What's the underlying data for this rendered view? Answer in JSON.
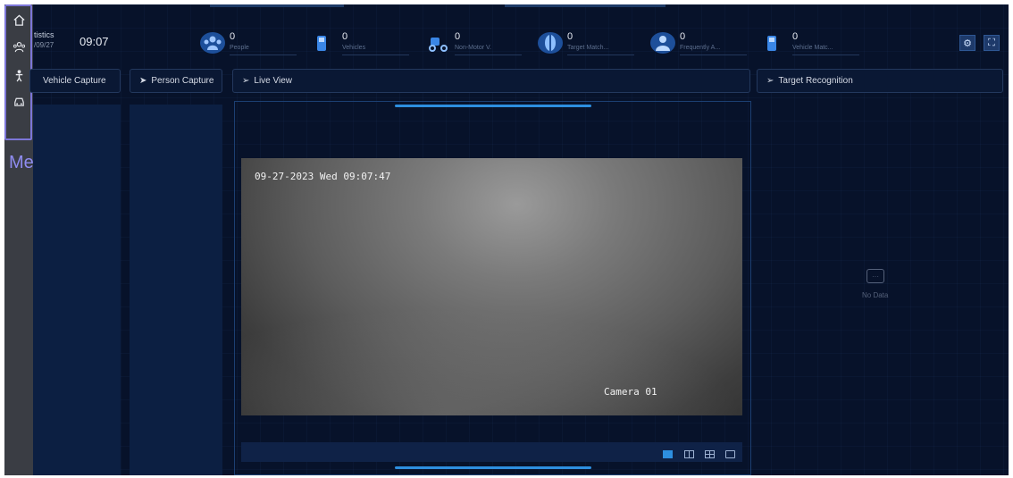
{
  "menu": {
    "label": "Menu Bar",
    "items": [
      {
        "icon": "home-icon"
      },
      {
        "icon": "people-group-icon"
      },
      {
        "icon": "person-icon"
      },
      {
        "icon": "car-icon"
      }
    ]
  },
  "header": {
    "statistics_title": "tistics",
    "statistics_date": "/09/27",
    "time": "09:07",
    "stats": [
      {
        "count": "0",
        "label": "People",
        "icon": "people-icon",
        "color": "#2f7fd8"
      },
      {
        "count": "0",
        "label": "Vehicles",
        "icon": "vehicle-icon",
        "color": "#2f7fd8"
      },
      {
        "count": "0",
        "label": "Non-Motor V.",
        "icon": "non-motor-vehicle-icon",
        "color": "#2f7fd8"
      },
      {
        "count": "0",
        "label": "Target Match...",
        "icon": "target-match-icon",
        "color": "#2f7fd8"
      },
      {
        "count": "0",
        "label": "Frequently A...",
        "icon": "frequently-appearing-icon",
        "color": "#2f7fd8"
      },
      {
        "count": "0",
        "label": "Vehicle Matc...",
        "icon": "vehicle-match-icon",
        "color": "#2f7fd8"
      }
    ],
    "tools": [
      {
        "icon": "settings-icon",
        "glyph": "⚙"
      },
      {
        "icon": "fullscreen-icon",
        "glyph": "⛶"
      }
    ]
  },
  "panels": {
    "vehicle_capture": "Vehicle Capture",
    "person_capture": "Person Capture",
    "live_view": "Live View",
    "target_recognition": "Target Recognition"
  },
  "video": {
    "osd_timestamp": "09-27-2023 Wed 09:07:47",
    "camera_name": "Camera 01",
    "layouts": [
      "single-window-icon",
      "two-window-icon",
      "four-window-icon",
      "custom-window-icon"
    ],
    "selected_layout": 0
  },
  "target_recognition": {
    "empty_text": "No Data"
  },
  "colors": {
    "background": "#07122a",
    "accent": "#2d8fe0",
    "menu_highlight": "#7c76d8"
  }
}
